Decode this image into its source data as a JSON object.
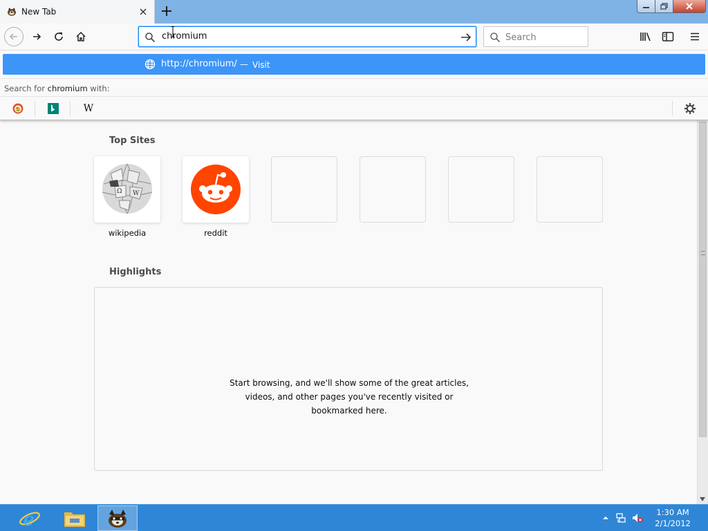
{
  "window": {
    "tab_title": "New Tab",
    "tab_icon": "firefox-nightly-favicon"
  },
  "navbar": {
    "url_value": "chromium",
    "search_placeholder": "Search"
  },
  "popup": {
    "suggestion_url": "http://chromium/",
    "suggestion_separator": "—",
    "suggestion_action": "Visit",
    "oneoff_prefix": "Search for ",
    "oneoff_term": "chromium",
    "oneoff_suffix": " with:",
    "engines": [
      "duckduckgo-icon",
      "bing-icon",
      "wikipedia-icon"
    ],
    "wikipedia_glyph": "W"
  },
  "content": {
    "top_sites_title": "Top Sites",
    "sites": [
      {
        "label": "wikipedia",
        "icon": "wikipedia-globe-icon"
      },
      {
        "label": "reddit",
        "icon": "reddit-icon"
      }
    ],
    "highlights_title": "Highlights",
    "highlights_message": "Start browsing, and we'll show some of the great articles, videos, and other pages you've recently visited or bookmarked here."
  },
  "taskbar": {
    "apps": [
      "internet-explorer-icon",
      "file-explorer-icon",
      "firefox-nightly-icon"
    ],
    "time": "1:30 AM",
    "date": "2/1/2012"
  },
  "colors": {
    "accent": "#0a84ff",
    "suggestion_bg": "#3d95f8",
    "reddit": "#ff4500",
    "taskbar": "#2f86d6"
  }
}
